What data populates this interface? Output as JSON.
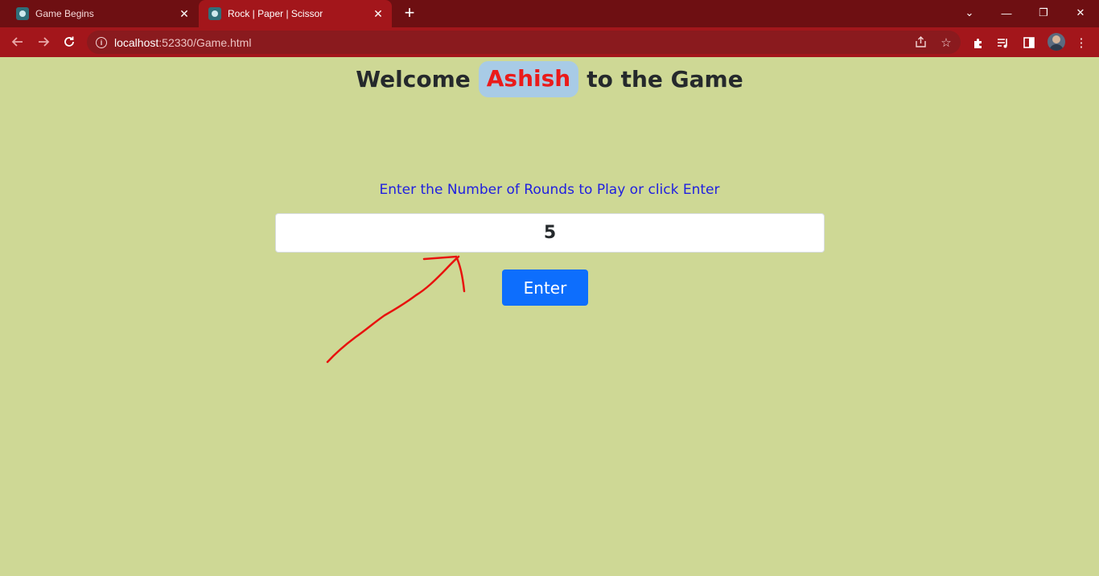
{
  "browser": {
    "tabs": [
      {
        "title": "Game Begins",
        "active": false
      },
      {
        "title": "Rock | Paper | Scissor",
        "active": true
      }
    ],
    "url_host": "localhost",
    "url_rest": ":52330/Game.html"
  },
  "page": {
    "heading_pre": "Welcome",
    "player_name": "Ashish",
    "heading_post": "to the Game",
    "prompt": "Enter the Number of Rounds to Play or click Enter",
    "rounds_value": "5",
    "enter_label": "Enter"
  },
  "colors": {
    "page_background": "#ced895",
    "browser_frame": "#a3161b",
    "name_text": "#ea1b1b",
    "name_pill": "#a8cbe6",
    "prompt_text": "#1f1fe0",
    "button": "#0d6efd",
    "annotation_arrow": "#e8120e"
  },
  "icons": [
    "back-arrow-icon",
    "forward-arrow-icon",
    "reload-icon",
    "info-icon",
    "share-icon",
    "bookmark-star-icon",
    "extensions-icon",
    "media-icon",
    "side-panel-icon",
    "menu-dots-icon"
  ]
}
